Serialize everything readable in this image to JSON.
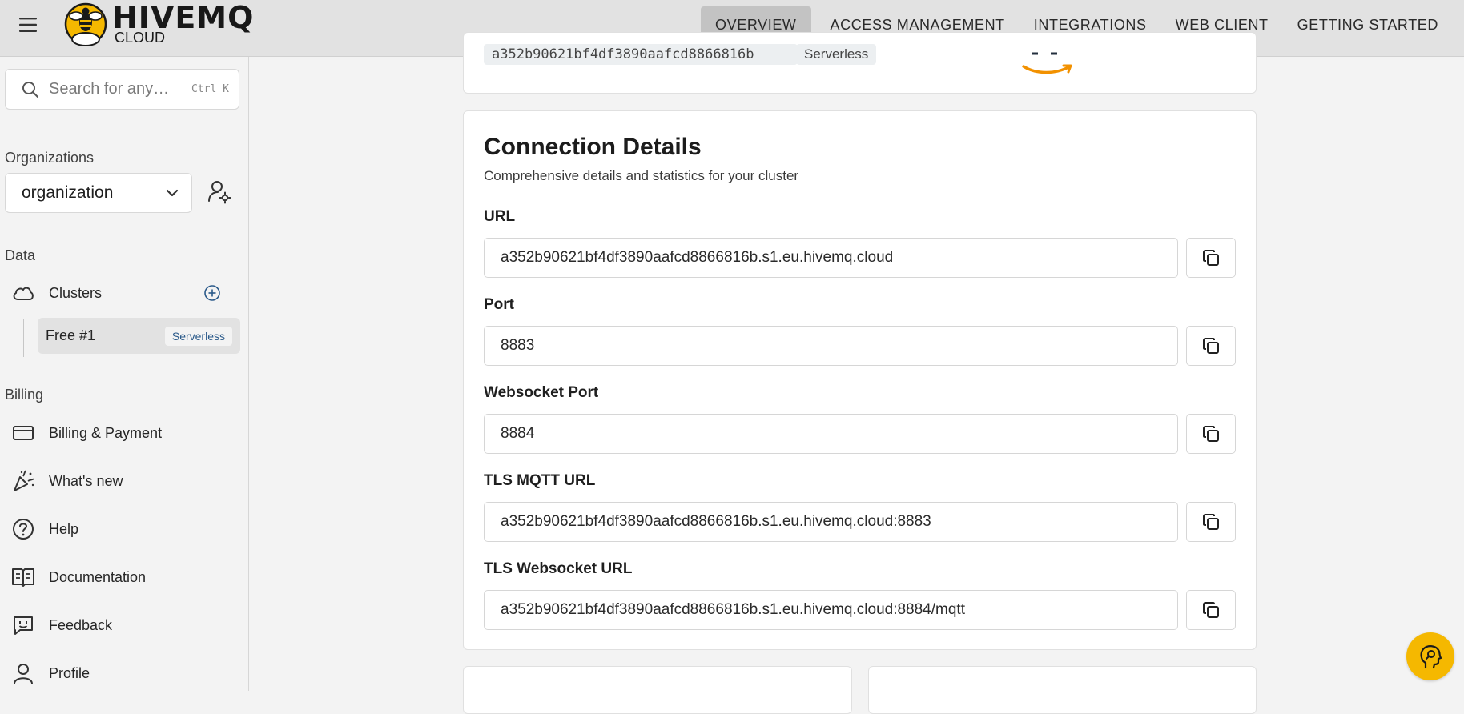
{
  "header": {
    "logo_word": "HIVEMQ",
    "logo_sub": "CLOUD",
    "nav": [
      "OVERVIEW",
      "ACCESS MANAGEMENT",
      "INTEGRATIONS",
      "WEB CLIENT",
      "GETTING STARTED"
    ],
    "active_nav": "OVERVIEW"
  },
  "sidebar": {
    "search": {
      "placeholder": "Search for any…",
      "shortcut": "Ctrl K"
    },
    "organizations_label": "Organizations",
    "organization_value": "organization",
    "data_label": "Data",
    "clusters_label": "Clusters",
    "cluster_item": {
      "name": "Free #1",
      "badge": "Serverless"
    },
    "billing_label": "Billing",
    "items": [
      {
        "label": "Billing & Payment",
        "icon": "credit-card-icon"
      },
      {
        "label": "What's new",
        "icon": "party-popper-icon"
      },
      {
        "label": "Help",
        "icon": "help-circle-icon"
      },
      {
        "label": "Documentation",
        "icon": "book-icon"
      },
      {
        "label": "Feedback",
        "icon": "feedback-icon"
      },
      {
        "label": "Profile",
        "icon": "user-icon"
      }
    ]
  },
  "top_card": {
    "cluster_id_chip": "a352b90621bf4df3890aafcd8866816b",
    "type_chip": "Serverless",
    "provider_logo": "aws"
  },
  "connection": {
    "title": "Connection Details",
    "subtitle": "Comprehensive details and statistics for your cluster",
    "fields": [
      {
        "label": "URL",
        "value": "a352b90621bf4df3890aafcd8866816b.s1.eu.hivemq.cloud"
      },
      {
        "label": "Port",
        "value": "8883"
      },
      {
        "label": "Websocket Port",
        "value": "8884"
      },
      {
        "label": "TLS MQTT URL",
        "value": "a352b90621bf4df3890aafcd8866816b.s1.eu.hivemq.cloud:8883"
      },
      {
        "label": "TLS Websocket URL",
        "value": "a352b90621bf4df3890aafcd8866816b.s1.eu.hivemq.cloud:8884/mqtt"
      }
    ]
  },
  "colors": {
    "brand_yellow": "#f5b800",
    "aws_orange": "#f29100",
    "badge_blue": "#2b5a8a"
  }
}
